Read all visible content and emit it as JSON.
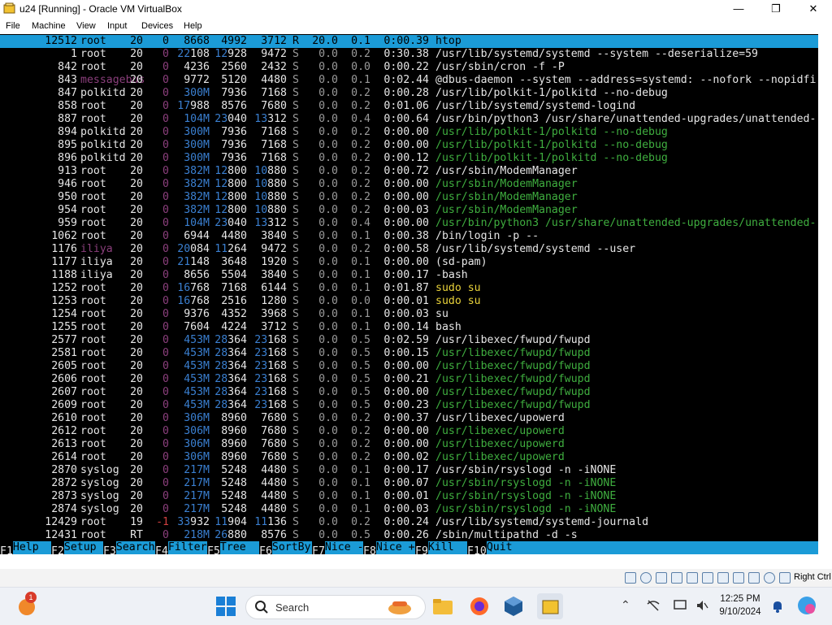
{
  "window": {
    "title": "u24 [Running] - Oracle VM VirtualBox",
    "minimize": "—",
    "maximize": "❐",
    "close": "✕"
  },
  "menu": [
    "File",
    "Machine",
    "View",
    "Input",
    "Devices",
    "Help"
  ],
  "htop": {
    "selected_index": 0,
    "rows": [
      {
        "pid": "12512",
        "user": "root",
        "pri": "20",
        "ni": "0",
        "virt": "8668",
        "res": "4992",
        "shr": "3712",
        "s": "R",
        "cpu": "20.0",
        "mem": "0.1",
        "time": "0:00.39",
        "cmd": "htop",
        "cmd_style": "main"
      },
      {
        "pid": "1",
        "user": "root",
        "pri": "20",
        "ni": "0",
        "virt": "22108",
        "res": "12928",
        "shr": "9472",
        "s": "S",
        "cpu": "0.0",
        "mem": "0.2",
        "time": "0:30.38",
        "cmd": "/usr/lib/systemd/systemd --system --deserialize=59",
        "cmd_style": "main"
      },
      {
        "pid": "842",
        "user": "root",
        "pri": "20",
        "ni": "0",
        "virt": "4236",
        "res": "2560",
        "shr": "2432",
        "s": "S",
        "cpu": "0.0",
        "mem": "0.0",
        "time": "0:00.22",
        "cmd": "/usr/sbin/cron -f -P",
        "cmd_style": "main"
      },
      {
        "pid": "843",
        "user": "messagebus",
        "pri": "20",
        "ni": "0",
        "virt": "9772",
        "res": "5120",
        "shr": "4480",
        "s": "S",
        "cpu": "0.0",
        "mem": "0.1",
        "time": "0:02.44",
        "cmd": "@dbus-daemon --system --address=systemd: --nofork --nopidfi",
        "cmd_style": "main",
        "user_style": "dim"
      },
      {
        "pid": "847",
        "user": "polkitd",
        "pri": "20",
        "ni": "0",
        "virt": "300M",
        "res": "7936",
        "shr": "7168",
        "s": "S",
        "cpu": "0.0",
        "mem": "0.2",
        "time": "0:00.28",
        "cmd": "/usr/lib/polkit-1/polkitd --no-debug",
        "cmd_style": "main"
      },
      {
        "pid": "858",
        "user": "root",
        "pri": "20",
        "ni": "0",
        "virt": "17988",
        "res": "8576",
        "shr": "7680",
        "s": "S",
        "cpu": "0.0",
        "mem": "0.2",
        "time": "0:01.06",
        "cmd": "/usr/lib/systemd/systemd-logind",
        "cmd_style": "main"
      },
      {
        "pid": "887",
        "user": "root",
        "pri": "20",
        "ni": "0",
        "virt": "104M",
        "res": "23040",
        "shr": "13312",
        "s": "S",
        "cpu": "0.0",
        "mem": "0.4",
        "time": "0:00.64",
        "cmd": "/usr/bin/python3 /usr/share/unattended-upgrades/unattended-",
        "cmd_style": "main"
      },
      {
        "pid": "894",
        "user": "polkitd",
        "pri": "20",
        "ni": "0",
        "virt": "300M",
        "res": "7936",
        "shr": "7168",
        "s": "S",
        "cpu": "0.0",
        "mem": "0.2",
        "time": "0:00.00",
        "cmd": "/usr/lib/polkit-1/polkitd --no-debug",
        "cmd_style": "thread"
      },
      {
        "pid": "895",
        "user": "polkitd",
        "pri": "20",
        "ni": "0",
        "virt": "300M",
        "res": "7936",
        "shr": "7168",
        "s": "S",
        "cpu": "0.0",
        "mem": "0.2",
        "time": "0:00.00",
        "cmd": "/usr/lib/polkit-1/polkitd --no-debug",
        "cmd_style": "thread"
      },
      {
        "pid": "896",
        "user": "polkitd",
        "pri": "20",
        "ni": "0",
        "virt": "300M",
        "res": "7936",
        "shr": "7168",
        "s": "S",
        "cpu": "0.0",
        "mem": "0.2",
        "time": "0:00.12",
        "cmd": "/usr/lib/polkit-1/polkitd --no-debug",
        "cmd_style": "thread"
      },
      {
        "pid": "913",
        "user": "root",
        "pri": "20",
        "ni": "0",
        "virt": "382M",
        "res": "12800",
        "shr": "10880",
        "s": "S",
        "cpu": "0.0",
        "mem": "0.2",
        "time": "0:00.72",
        "cmd": "/usr/sbin/ModemManager",
        "cmd_style": "main"
      },
      {
        "pid": "946",
        "user": "root",
        "pri": "20",
        "ni": "0",
        "virt": "382M",
        "res": "12800",
        "shr": "10880",
        "s": "S",
        "cpu": "0.0",
        "mem": "0.2",
        "time": "0:00.00",
        "cmd": "/usr/sbin/ModemManager",
        "cmd_style": "thread"
      },
      {
        "pid": "950",
        "user": "root",
        "pri": "20",
        "ni": "0",
        "virt": "382M",
        "res": "12800",
        "shr": "10880",
        "s": "S",
        "cpu": "0.0",
        "mem": "0.2",
        "time": "0:00.00",
        "cmd": "/usr/sbin/ModemManager",
        "cmd_style": "thread"
      },
      {
        "pid": "954",
        "user": "root",
        "pri": "20",
        "ni": "0",
        "virt": "382M",
        "res": "12800",
        "shr": "10880",
        "s": "S",
        "cpu": "0.0",
        "mem": "0.2",
        "time": "0:00.03",
        "cmd": "/usr/sbin/ModemManager",
        "cmd_style": "thread"
      },
      {
        "pid": "959",
        "user": "root",
        "pri": "20",
        "ni": "0",
        "virt": "104M",
        "res": "23040",
        "shr": "13312",
        "s": "S",
        "cpu": "0.0",
        "mem": "0.4",
        "time": "0:00.00",
        "cmd": "/usr/bin/python3 /usr/share/unattended-upgrades/unattended-",
        "cmd_style": "thread"
      },
      {
        "pid": "1062",
        "user": "root",
        "pri": "20",
        "ni": "0",
        "virt": "6944",
        "res": "4480",
        "shr": "3840",
        "s": "S",
        "cpu": "0.0",
        "mem": "0.1",
        "time": "0:00.38",
        "cmd": "/bin/login -p --",
        "cmd_style": "main"
      },
      {
        "pid": "1176",
        "user": "iliya",
        "pri": "20",
        "ni": "0",
        "virt": "20084",
        "res": "11264",
        "shr": "9472",
        "s": "S",
        "cpu": "0.0",
        "mem": "0.2",
        "time": "0:00.58",
        "cmd": "/usr/lib/systemd/systemd --user",
        "cmd_style": "main",
        "user_style": "dim"
      },
      {
        "pid": "1177",
        "user": "iliya",
        "pri": "20",
        "ni": "0",
        "virt": "21148",
        "res": "3648",
        "shr": "1920",
        "s": "S",
        "cpu": "0.0",
        "mem": "0.1",
        "time": "0:00.00",
        "cmd": "(sd-pam)",
        "cmd_style": "main"
      },
      {
        "pid": "1188",
        "user": "iliya",
        "pri": "20",
        "ni": "0",
        "virt": "8656",
        "res": "5504",
        "shr": "3840",
        "s": "S",
        "cpu": "0.0",
        "mem": "0.1",
        "time": "0:00.17",
        "cmd": "-bash",
        "cmd_style": "main"
      },
      {
        "pid": "1252",
        "user": "root",
        "pri": "20",
        "ni": "0",
        "virt": "16768",
        "res": "7168",
        "shr": "6144",
        "s": "S",
        "cpu": "0.0",
        "mem": "0.1",
        "time": "0:01.87",
        "cmd": "sudo su",
        "cmd_style": "sudo"
      },
      {
        "pid": "1253",
        "user": "root",
        "pri": "20",
        "ni": "0",
        "virt": "16768",
        "res": "2516",
        "shr": "1280",
        "s": "S",
        "cpu": "0.0",
        "mem": "0.0",
        "time": "0:00.01",
        "cmd": "sudo su",
        "cmd_style": "sudo"
      },
      {
        "pid": "1254",
        "user": "root",
        "pri": "20",
        "ni": "0",
        "virt": "9376",
        "res": "4352",
        "shr": "3968",
        "s": "S",
        "cpu": "0.0",
        "mem": "0.1",
        "time": "0:00.03",
        "cmd": "su",
        "cmd_style": "main"
      },
      {
        "pid": "1255",
        "user": "root",
        "pri": "20",
        "ni": "0",
        "virt": "7604",
        "res": "4224",
        "shr": "3712",
        "s": "S",
        "cpu": "0.0",
        "mem": "0.1",
        "time": "0:00.14",
        "cmd": "bash",
        "cmd_style": "main"
      },
      {
        "pid": "2577",
        "user": "root",
        "pri": "20",
        "ni": "0",
        "virt": "453M",
        "res": "28364",
        "shr": "23168",
        "s": "S",
        "cpu": "0.0",
        "mem": "0.5",
        "time": "0:02.59",
        "cmd": "/usr/libexec/fwupd/fwupd",
        "cmd_style": "main"
      },
      {
        "pid": "2581",
        "user": "root",
        "pri": "20",
        "ni": "0",
        "virt": "453M",
        "res": "28364",
        "shr": "23168",
        "s": "S",
        "cpu": "0.0",
        "mem": "0.5",
        "time": "0:00.15",
        "cmd": "/usr/libexec/fwupd/fwupd",
        "cmd_style": "thread"
      },
      {
        "pid": "2605",
        "user": "root",
        "pri": "20",
        "ni": "0",
        "virt": "453M",
        "res": "28364",
        "shr": "23168",
        "s": "S",
        "cpu": "0.0",
        "mem": "0.5",
        "time": "0:00.00",
        "cmd": "/usr/libexec/fwupd/fwupd",
        "cmd_style": "thread"
      },
      {
        "pid": "2606",
        "user": "root",
        "pri": "20",
        "ni": "0",
        "virt": "453M",
        "res": "28364",
        "shr": "23168",
        "s": "S",
        "cpu": "0.0",
        "mem": "0.5",
        "time": "0:00.21",
        "cmd": "/usr/libexec/fwupd/fwupd",
        "cmd_style": "thread"
      },
      {
        "pid": "2607",
        "user": "root",
        "pri": "20",
        "ni": "0",
        "virt": "453M",
        "res": "28364",
        "shr": "23168",
        "s": "S",
        "cpu": "0.0",
        "mem": "0.5",
        "time": "0:00.00",
        "cmd": "/usr/libexec/fwupd/fwupd",
        "cmd_style": "thread"
      },
      {
        "pid": "2609",
        "user": "root",
        "pri": "20",
        "ni": "0",
        "virt": "453M",
        "res": "28364",
        "shr": "23168",
        "s": "S",
        "cpu": "0.0",
        "mem": "0.5",
        "time": "0:00.23",
        "cmd": "/usr/libexec/fwupd/fwupd",
        "cmd_style": "thread"
      },
      {
        "pid": "2610",
        "user": "root",
        "pri": "20",
        "ni": "0",
        "virt": "306M",
        "res": "8960",
        "shr": "7680",
        "s": "S",
        "cpu": "0.0",
        "mem": "0.2",
        "time": "0:00.37",
        "cmd": "/usr/libexec/upowerd",
        "cmd_style": "main"
      },
      {
        "pid": "2612",
        "user": "root",
        "pri": "20",
        "ni": "0",
        "virt": "306M",
        "res": "8960",
        "shr": "7680",
        "s": "S",
        "cpu": "0.0",
        "mem": "0.2",
        "time": "0:00.00",
        "cmd": "/usr/libexec/upowerd",
        "cmd_style": "thread"
      },
      {
        "pid": "2613",
        "user": "root",
        "pri": "20",
        "ni": "0",
        "virt": "306M",
        "res": "8960",
        "shr": "7680",
        "s": "S",
        "cpu": "0.0",
        "mem": "0.2",
        "time": "0:00.00",
        "cmd": "/usr/libexec/upowerd",
        "cmd_style": "thread"
      },
      {
        "pid": "2614",
        "user": "root",
        "pri": "20",
        "ni": "0",
        "virt": "306M",
        "res": "8960",
        "shr": "7680",
        "s": "S",
        "cpu": "0.0",
        "mem": "0.2",
        "time": "0:00.02",
        "cmd": "/usr/libexec/upowerd",
        "cmd_style": "thread"
      },
      {
        "pid": "2870",
        "user": "syslog",
        "pri": "20",
        "ni": "0",
        "virt": "217M",
        "res": "5248",
        "shr": "4480",
        "s": "S",
        "cpu": "0.0",
        "mem": "0.1",
        "time": "0:00.17",
        "cmd": "/usr/sbin/rsyslogd -n -iNONE",
        "cmd_style": "main"
      },
      {
        "pid": "2872",
        "user": "syslog",
        "pri": "20",
        "ni": "0",
        "virt": "217M",
        "res": "5248",
        "shr": "4480",
        "s": "S",
        "cpu": "0.0",
        "mem": "0.1",
        "time": "0:00.07",
        "cmd": "/usr/sbin/rsyslogd -n -iNONE",
        "cmd_style": "thread"
      },
      {
        "pid": "2873",
        "user": "syslog",
        "pri": "20",
        "ni": "0",
        "virt": "217M",
        "res": "5248",
        "shr": "4480",
        "s": "S",
        "cpu": "0.0",
        "mem": "0.1",
        "time": "0:00.01",
        "cmd": "/usr/sbin/rsyslogd -n -iNONE",
        "cmd_style": "thread"
      },
      {
        "pid": "2874",
        "user": "syslog",
        "pri": "20",
        "ni": "0",
        "virt": "217M",
        "res": "5248",
        "shr": "4480",
        "s": "S",
        "cpu": "0.0",
        "mem": "0.1",
        "time": "0:00.03",
        "cmd": "/usr/sbin/rsyslogd -n -iNONE",
        "cmd_style": "thread"
      },
      {
        "pid": "12429",
        "user": "root",
        "pri": "19",
        "ni": "-1",
        "virt": "33932",
        "res": "11904",
        "shr": "11136",
        "s": "S",
        "cpu": "0.0",
        "mem": "0.2",
        "time": "0:00.24",
        "cmd": "/usr/lib/systemd/systemd-journald",
        "cmd_style": "main"
      },
      {
        "pid": "12431",
        "user": "root",
        "pri": "RT",
        "ni": "0",
        "virt": "218M",
        "res": "26880",
        "shr": "8576",
        "s": "S",
        "cpu": "0.0",
        "mem": "0.5",
        "time": "0:00.26",
        "cmd": "/sbin/multipathd -d -s",
        "cmd_style": "main"
      }
    ],
    "fkeys": [
      {
        "key": "F1",
        "label": "Help"
      },
      {
        "key": "F2",
        "label": "Setup"
      },
      {
        "key": "F3",
        "label": "Search"
      },
      {
        "key": "F4",
        "label": "Filter"
      },
      {
        "key": "F5",
        "label": "Tree"
      },
      {
        "key": "F6",
        "label": "SortBy"
      },
      {
        "key": "F7",
        "label": "Nice -"
      },
      {
        "key": "F8",
        "label": "Nice +"
      },
      {
        "key": "F9",
        "label": "Kill"
      },
      {
        "key": "F10",
        "label": "Quit"
      }
    ]
  },
  "statusbar": {
    "host_key": "Right Ctrl"
  },
  "taskbar": {
    "search_placeholder": "Search",
    "notification_count": "1",
    "time": "12:25 PM",
    "date": "9/10/2024"
  },
  "colors": {
    "accent": "#1b9bd7",
    "terminal_bg": "#000000",
    "text": "#e6e6e6",
    "thread_green": "#3fae3f",
    "sudo_yellow": "#e8d23a",
    "dim_purple": "#8b3f7c",
    "num_blue": "#3a7fd0"
  }
}
